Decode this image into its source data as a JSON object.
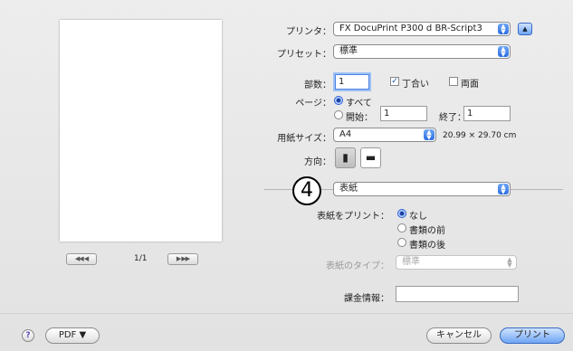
{
  "printer": {
    "label": "プリンタ：",
    "value": "FX DocuPrint P300 d BR-Script3"
  },
  "preset": {
    "label": "プリセット：",
    "value": "標準"
  },
  "copies": {
    "label": "部数：",
    "value": "1",
    "collate_label": "丁合い",
    "collate_checked": true,
    "duplex_label": "両面",
    "duplex_checked": false
  },
  "pages": {
    "label": "ページ：",
    "all_label": "すべて",
    "from_label": "開始：",
    "from_value": "1",
    "to_label": "終了：",
    "to_value": "1"
  },
  "paper": {
    "label": "用紙サイズ：",
    "value": "A4",
    "dimensions": "20.99 × 29.70 cm"
  },
  "orientation": {
    "label": "方向："
  },
  "annotation": {
    "number": "4"
  },
  "panel": {
    "value": "表紙"
  },
  "cover": {
    "print_label": "表紙をプリント：",
    "options": [
      "なし",
      "書類の前",
      "書類の後"
    ],
    "selected": "なし",
    "type_label": "表紙のタイプ：",
    "type_value": "標準"
  },
  "billing": {
    "label": "課金情報：",
    "value": ""
  },
  "preview": {
    "page_indicator": "1/1"
  },
  "footer": {
    "help": "?",
    "pdf_label": "PDF ▼",
    "cancel_label": "キャンセル",
    "print_label": "プリント"
  },
  "colors": {
    "accent": "#2b6de0"
  },
  "icons": {
    "first_page": "⏮",
    "prev_page": "◀",
    "next_page": "▶",
    "last_page": "⏭"
  }
}
